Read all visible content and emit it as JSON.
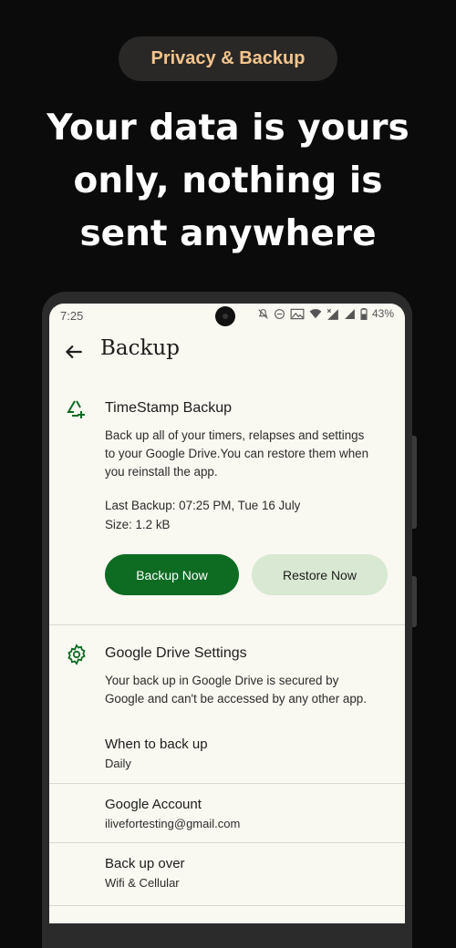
{
  "promo": {
    "pill_label": "Privacy & Backup",
    "headline": [
      "Your data is yours",
      "only, nothing is",
      "sent anywhere"
    ]
  },
  "status_bar": {
    "time": "7:25",
    "battery": "43%"
  },
  "app_bar": {
    "title": "Backup"
  },
  "timestamp_backup": {
    "title": "TimeStamp Backup",
    "description": [
      "Back up all of your timers, relapses and settings",
      "to your Google Drive.You can restore them when",
      "you reinstall the app."
    ],
    "last_backup": "Last Backup: 07:25 PM, Tue 16 July",
    "size": "Size: 1.2 kB",
    "backup_now_label": "Backup Now",
    "restore_now_label": "Restore Now"
  },
  "drive_settings": {
    "title": "Google Drive Settings",
    "description": [
      "Your back up in Google Drive is secured by",
      "Google and can't be accessed by any other app."
    ],
    "items": [
      {
        "label": "When to back up",
        "value": "Daily"
      },
      {
        "label": "Google Account",
        "value": "ilivefortesting@gmail.com"
      },
      {
        "label": "Back up over",
        "value": "Wifi & Cellular"
      }
    ]
  },
  "colors": {
    "accent": "#0d6b22",
    "secondary_button": "#d8e8d2",
    "screen_bg": "#f9f8f1",
    "promo_text": "#f3c58e"
  },
  "icons": {
    "back": "arrow-left-icon",
    "backup_section": "recycle-plus-icon",
    "settings_section": "gear-icon"
  }
}
